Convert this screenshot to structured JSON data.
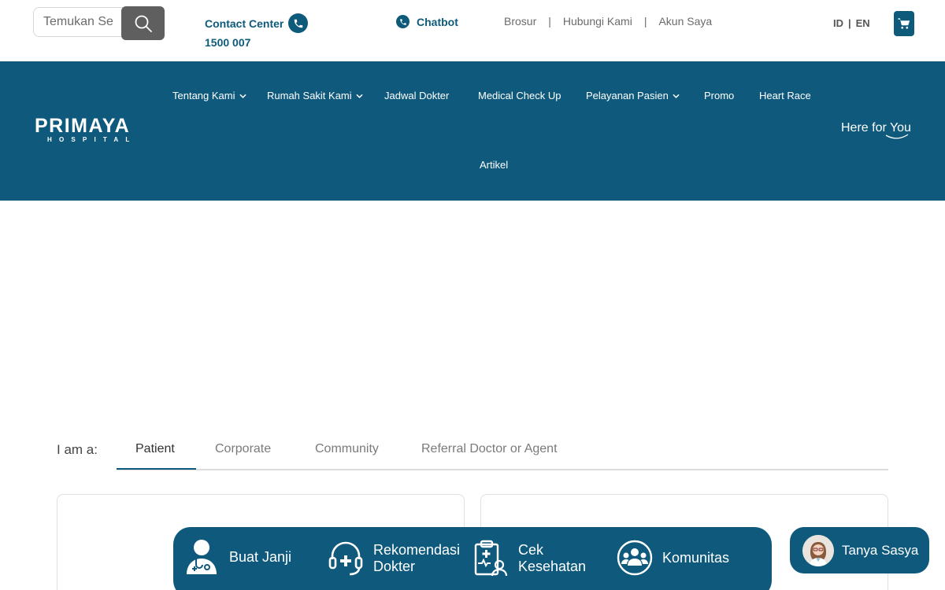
{
  "search": {
    "placeholder": "Temukan Se"
  },
  "contact": {
    "title": "Contact Center",
    "number": "1500 007"
  },
  "chatbot": {
    "label": "Chatbot"
  },
  "toplinks": [
    "Brosur",
    "Hubungi Kami",
    "Akun Saya"
  ],
  "lang": {
    "id": "ID",
    "sep": "|",
    "en": "EN"
  },
  "logo": {
    "name": "PRIMAYA",
    "sub": "HOSPITAL"
  },
  "nav": [
    {
      "label": "Tentang Kami",
      "dropdown": true
    },
    {
      "label": "Rumah Sakit Kami",
      "dropdown": true
    },
    {
      "label": "Jadwal Dokter",
      "dropdown": false
    },
    {
      "label": "Medical Check Up",
      "dropdown": false
    },
    {
      "label": "Pelayanan Pasien",
      "dropdown": true
    },
    {
      "label": "Promo",
      "dropdown": false
    },
    {
      "label": "Heart Race",
      "dropdown": false
    },
    {
      "label": "Artikel",
      "dropdown": false
    }
  ],
  "tagline": "Here for You",
  "audience": {
    "prompt": "I am a:",
    "tabs": [
      "Patient",
      "Corporate",
      "Community",
      "Referral Doctor or Agent"
    ],
    "active": "Patient"
  },
  "quickbar": [
    {
      "line1": "Buat Janji",
      "line2": "",
      "icon": "doctor-icon"
    },
    {
      "line1": "Rekomendasi",
      "line2": "Dokter",
      "icon": "headset-plus-icon"
    },
    {
      "line1": "Cek",
      "line2": "Kesehatan",
      "icon": "clipboard-health-icon"
    },
    {
      "line1": "Komunitas",
      "line2": "",
      "icon": "community-icon"
    }
  ],
  "assistant": {
    "label": "Tanya Sasya"
  },
  "colors": {
    "brand": "#0f5a7c",
    "search_button": "#5f5f5f"
  }
}
